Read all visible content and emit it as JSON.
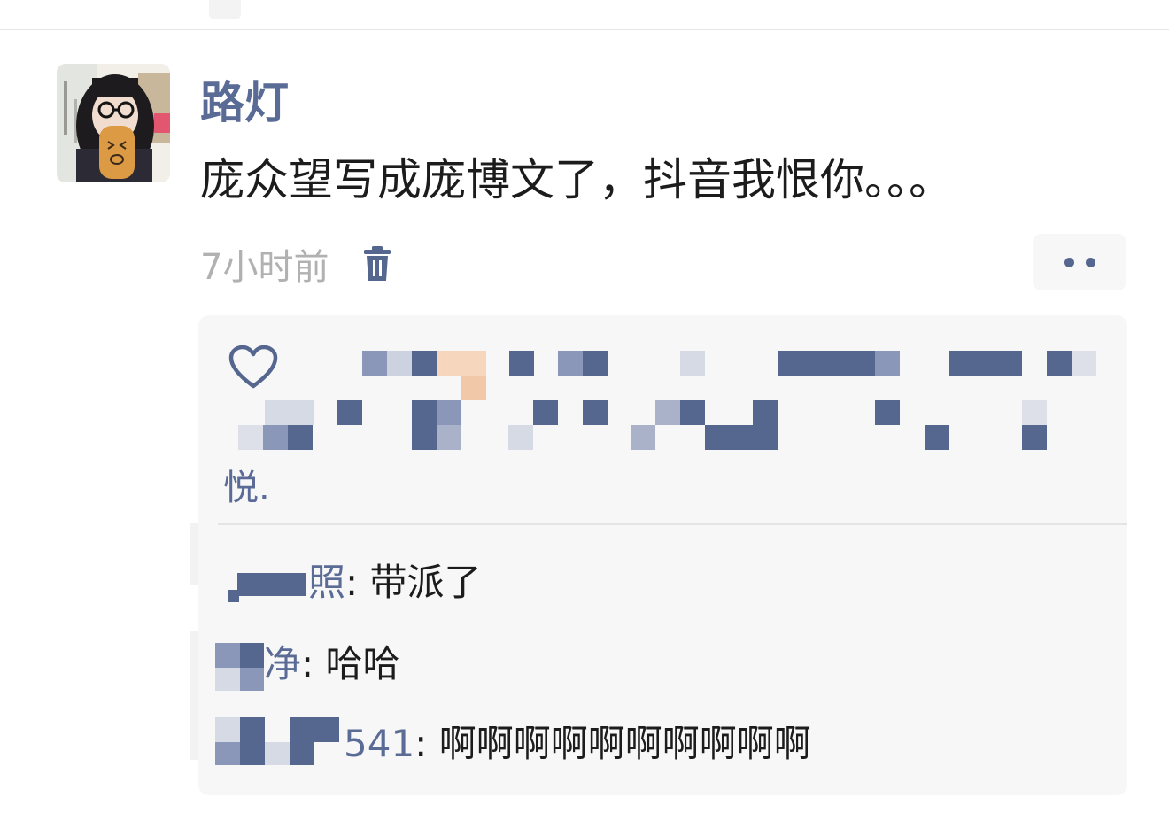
{
  "post": {
    "username": "路灯",
    "text": "庞众望写成庞博文了，抖音我恨你。。。",
    "timestamp": "7小时前",
    "icons": {
      "delete": "trash-icon",
      "more": "more-dots-icon"
    }
  },
  "interactions": {
    "like_icon": "heart-outline-icon",
    "likes_visible_tail": "悦.",
    "comments": [
      {
        "name_visible": "照",
        "separator": ": ",
        "text": "带派了"
      },
      {
        "name_visible": "净",
        "separator": ": ",
        "text": "哈哈"
      },
      {
        "name_visible": "541",
        "separator": ": ",
        "text": "啊啊啊啊啊啊啊啊啊啊"
      }
    ]
  },
  "colors": {
    "name_blue": "#5a6b96",
    "text": "#1c1c1c",
    "meta_gray": "#b1b1b1",
    "panel_bg": "#f7f7f7"
  }
}
